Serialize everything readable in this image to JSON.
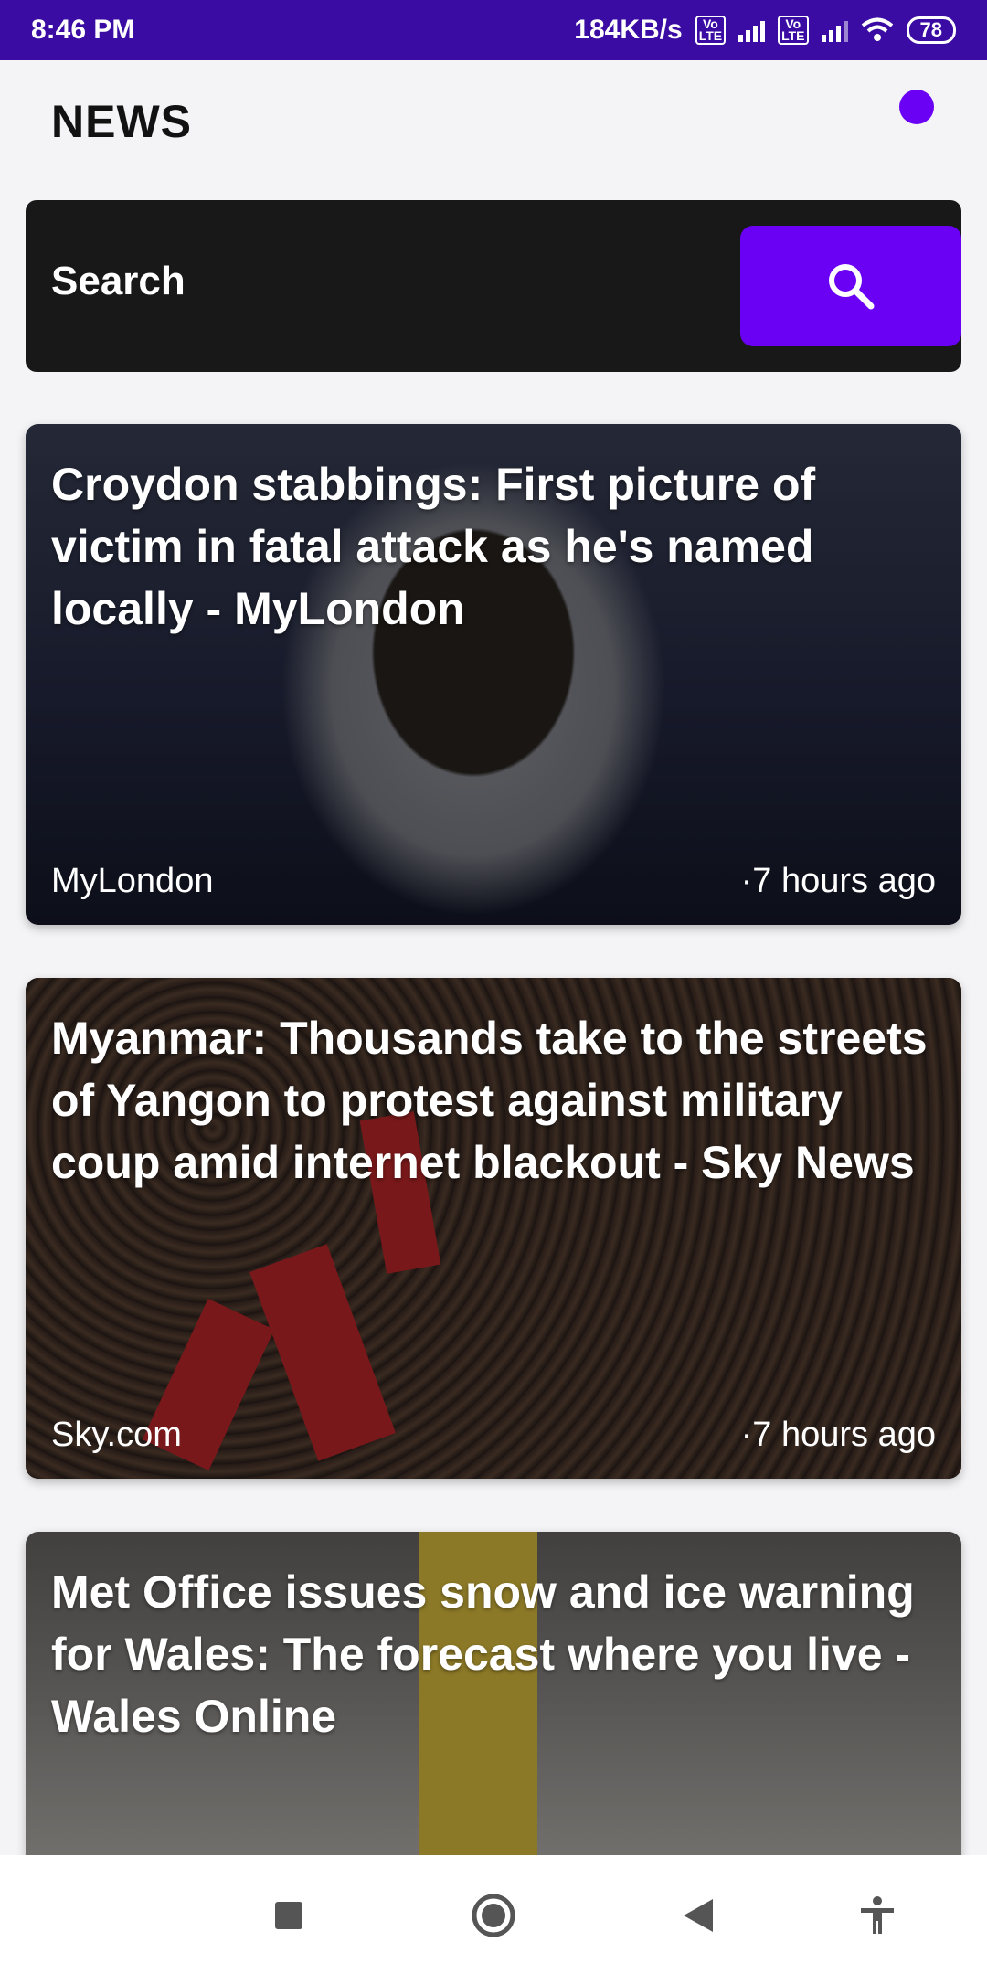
{
  "status_bar": {
    "time": "8:46 PM",
    "network_speed": "184KB/s",
    "volte_label": "Vo\nLTE",
    "battery": "78"
  },
  "header": {
    "title": "NEWS"
  },
  "search": {
    "label": "Search",
    "icon": "search-icon",
    "button_color": "#6a00f4"
  },
  "articles": [
    {
      "title": "Croydon stabbings: First picture of victim in fatal attack as he's named locally - MyLondon",
      "source": "MyLondon",
      "time": "·7 hours ago"
    },
    {
      "title": "Myanmar: Thousands take to the streets of Yangon to protest against military coup amid internet blackout - Sky News",
      "source": "Sky.com",
      "time": "·7 hours ago"
    },
    {
      "title": "Met Office issues snow and ice warning for Wales: The forecast where you live - Wales Online",
      "source": "",
      "time": ""
    }
  ],
  "nav_bar": {
    "icons": [
      "recents-square-icon",
      "home-circle-icon",
      "back-triangle-icon",
      "accessibility-icon"
    ]
  },
  "colors": {
    "accent": "#6a00f4",
    "status_bar": "#3a0ca3",
    "search_bg": "#181818"
  }
}
